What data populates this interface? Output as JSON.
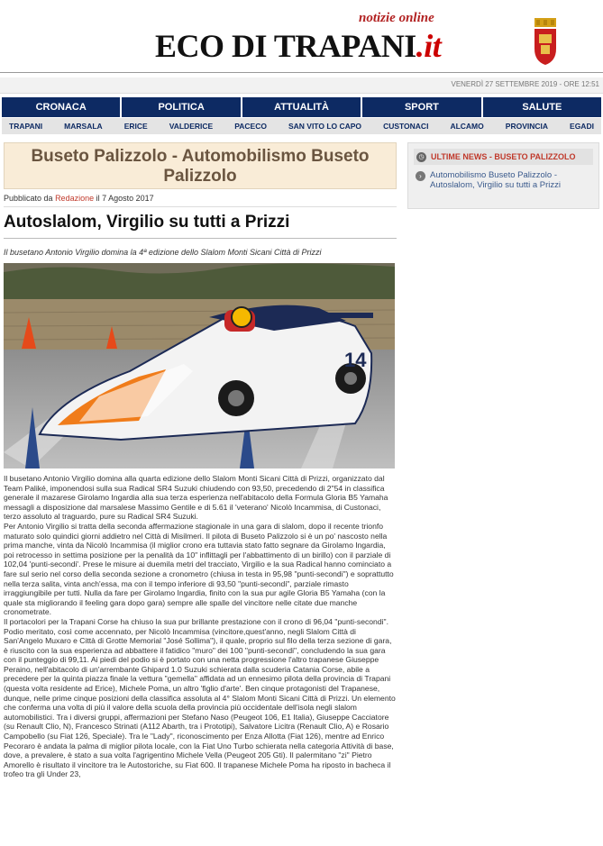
{
  "header": {
    "tagline": "notizie online",
    "logo_main": "ECO DI TRAPANI",
    "logo_suffix": ".it",
    "date": "VENERDÌ 27 SETTEMBRE 2019 - ORE 12:51"
  },
  "nav": {
    "main": [
      "CRONACA",
      "POLITICA",
      "ATTUALITÀ",
      "SPORT",
      "SALUTE"
    ],
    "sub": [
      "TRAPANI",
      "MARSALA",
      "ERICE",
      "VALDERICE",
      "PACECO",
      "SAN VITO LO CAPO",
      "CUSTONACI",
      "ALCAMO",
      "PROVINCIA",
      "EGADI"
    ]
  },
  "article": {
    "category_title": "Buseto Palizzolo - Automobilismo Buseto Palizzolo",
    "published_prefix": "Pubblicato da",
    "author": "Redazione",
    "published_date": "il 7 Agosto 2017",
    "headline": "Autoslalom, Virgilio su tutti a Prizzi",
    "subtitle": "Il busetano Antonio Virgilio domina la 4ª edizione dello Slalom Monti Sicani Città di Prizzi",
    "car_number": "14",
    "paragraphs": [
      "Il busetano Antonio Virgilio domina alla quarta edizione dello Slalom Monti Sicani Città di Prizzi, organizzato dal Team Paliké, imponendosi sulla sua Radical SR4 Suzuki chiudendo con 93,50, precedendo di 2\"54 in classifica generale il mazarese Girolamo Ingardia alla sua terza esperienza nell'abitacolo della Formula Gloria B5 Yamaha messagli a disposizione dal marsalese Massimo Gentile e di 5.61 il 'veterano' Nicolò Incammisa, di Custonaci, terzo assoluto al traguardo, pure su Radical SR4 Suzuki.",
      "Per Antonio Virgilio si tratta della seconda affermazione stagionale in una gara di slalom, dopo il recente trionfo maturato solo quindici giorni addietro nel Città di Misilmeri. Il pilota di Buseto Palizzolo si è un po' nascosto nella prima manche, vinta da Nicolò Incammisa (il miglior crono era tuttavia stato fatto segnare da Girolamo Ingardia, poi retrocesso in settima posizione per la penalità da 10\" inflittagli per l'abbattimento di un birillo) con il parziale di 102,04 'punti-secondi'. Prese le misure ai duemila metri del tracciato, Virgilio e la sua Radical hanno cominciato a fare sul serio nel corso della seconda sezione a cronometro (chiusa in testa in 95,98 \"punti-secondi\") e soprattutto nella terza salita, vinta anch'essa, ma con il tempo inferiore di 93,50 \"punti-secondi\", parziale rimasto irraggiungibile per tutti. Nulla da fare per Girolamo Ingardia, finito con la sua pur agile Gloria B5 Yamaha (con la quale sta migliorando il feeling gara dopo gara) sempre alle spalle del vincitore nelle citate due manche cronometrate.",
      "Il portacolori per la Trapani Corse ha chiuso la sua pur brillante prestazione con il crono di 96,04 \"punti-secondi\". Podio meritato, così come accennato, per Nicolò Incammisa (vincitore,quest'anno, negli Slalom Città di San'Angelo Muxaro e Città di Grotte Memorial \"José Sollima\"), il quale, proprio sul filo della terza sezione di gara, è riuscito con la sua esperienza ad abbattere il fatidico \"muro\" dei 100 \"punti-secondi\", concludendo la sua gara con il punteggio di 99,11. Ai piedi del podio si è portato con una netta progressione l'altro trapanese Giuseppe Peraino, nell'abitacolo di un'arrembante Ghipard 1.0 Suzuki schierata dalla scuderia Catania Corse, abile a precedere per la quinta piazza finale la vettura \"gemella\" affidata ad un ennesimo pilota della provincia di Trapani (questa volta residente ad Erice), Michele Poma, un altro 'figlio d'arte'. Ben cinque protagonisti del Trapanese, dunque, nelle prime cinque posizioni della classifica assoluta al 4° Slalom Monti Sicani Città di Prizzi. Un elemento che conferma una volta di più il valore della scuola della provincia più occidentale dell'isola negli slalom automobilistici. Tra i diversi gruppi, affermazioni per Stefano Naso (Peugeot 106, E1 Italia), Giuseppe Cacciatore (su Renault Clio, N), Francesco Strinati (A112 Abarth, tra i Prototipi), Salvatore Licitra (Renault Clio, A) e Rosario Campobello (su Fiat 126, Speciale). Tra le \"Lady\", riconoscimento per Enza Allotta (Fiat 126), mentre ad Enrico Pecoraro è andata la palma di miglior pilota locale, con la Fiat Uno Turbo schierata nella categoria Attività di base, dove, a prevalere, è stato a sua volta l'agrigentino Michele Vella (Peugeot 205 Gti). Il palermitano \"zi\" Pietro Amorello è risultato il vincitore tra le Autostoriche, su Fiat 600. Il trapanese Michele Poma ha riposto in bacheca il trofeo tra gli Under 23,"
    ]
  },
  "sidebar": {
    "title": "ULTIME NEWS - BUSETO PALIZZOLO",
    "items": [
      "Automobilismo Buseto Palizzolo - Autoslalom, Virgilio su tutti a Prizzi"
    ]
  },
  "colors": {
    "nav_bg": "#0d2a63",
    "accent_red": "#c0392b",
    "category_bg": "#f9ecd7"
  },
  "icons": {
    "sidebar_header": "clock-icon",
    "sidebar_bullet": "arrow-right-icon",
    "crest": "trapani-crest-icon"
  }
}
